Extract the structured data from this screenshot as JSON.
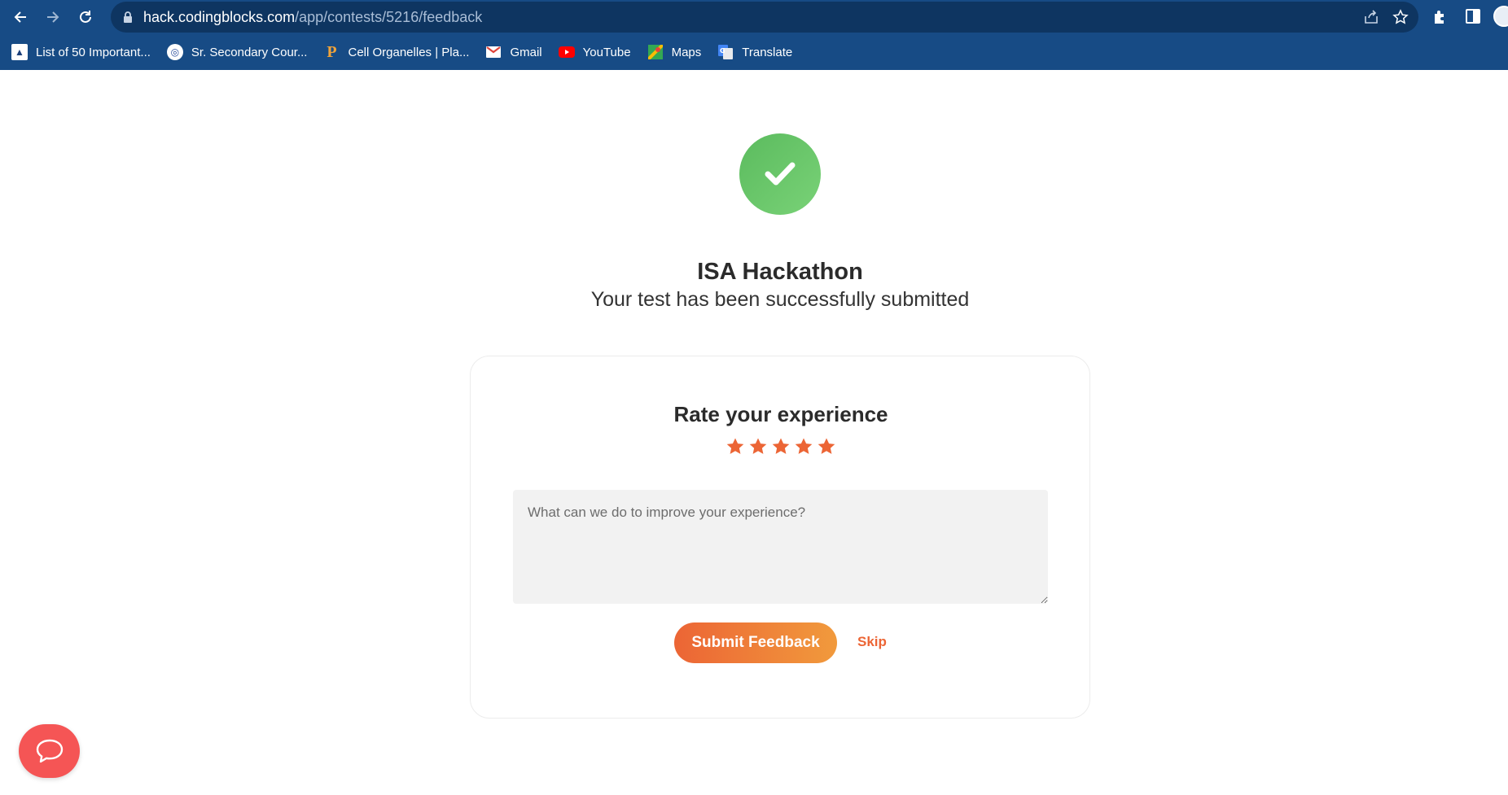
{
  "browser": {
    "url_host": "hack.codingblocks.com",
    "url_path": "/app/contests/5216/feedback",
    "bookmarks": [
      {
        "label": "List of 50 Important...",
        "icon": "bookmark-site-icon"
      },
      {
        "label": "Sr. Secondary Cour...",
        "icon": "bookmark-site-icon"
      },
      {
        "label": "Cell Organelles | Pla...",
        "icon": "letter-p-icon"
      },
      {
        "label": "Gmail",
        "icon": "gmail-icon"
      },
      {
        "label": "YouTube",
        "icon": "youtube-icon"
      },
      {
        "label": "Maps",
        "icon": "maps-icon"
      },
      {
        "label": "Translate",
        "icon": "translate-icon"
      }
    ]
  },
  "page": {
    "contest_title": "ISA Hackathon",
    "status_message": "Your test has been successfully submitted",
    "rating": {
      "heading": "Rate your experience",
      "stars": 5,
      "star_color": "#ec6535"
    },
    "feedback_placeholder": "What can we do to improve your experience?",
    "submit_label": "Submit Feedback",
    "skip_label": "Skip"
  },
  "colors": {
    "browser_chrome": "#174b85",
    "success_green": "#5bbb5e",
    "accent_orange": "#ec6535",
    "chat_button": "#f55555"
  }
}
